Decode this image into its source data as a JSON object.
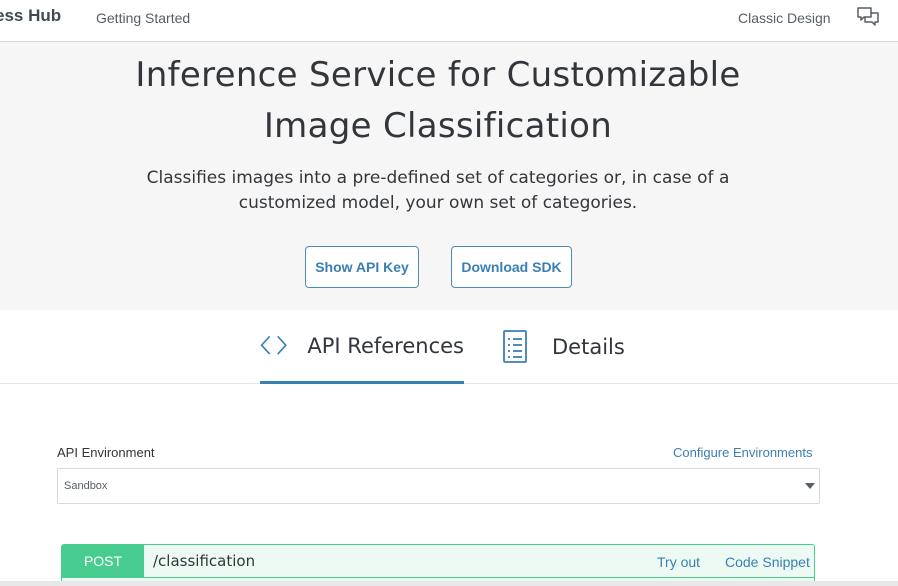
{
  "topbar": {
    "brand": "ess Hub",
    "getting_started": "Getting Started",
    "classic_design": "Classic Design",
    "feedback_icon": "chat-bubbles-icon"
  },
  "hero": {
    "title_line1": "Inference Service for Customizable",
    "title_line2": "Image Classification",
    "desc_line1": "Classifies images into a pre-defined set of categories or, in case of a",
    "desc_line2": "customized model, your own set of categories.",
    "show_api_key": "Show API Key",
    "download_sdk": "Download SDK"
  },
  "tabs": {
    "api_references": "API References",
    "api_icon": "code-brackets-icon",
    "details": "Details",
    "details_icon": "document-list-icon",
    "active": "API References"
  },
  "environment": {
    "label": "API Environment",
    "configure": "Configure Environments",
    "selected": "Sandbox"
  },
  "endpoint": {
    "method": "POST",
    "path": "/classification",
    "try_out": "Try out",
    "code_snippet": "Code Snippet"
  },
  "colors": {
    "accent": "#3a7fb4",
    "post_green": "#49cc90",
    "hero_bg": "#f6f6f6"
  }
}
